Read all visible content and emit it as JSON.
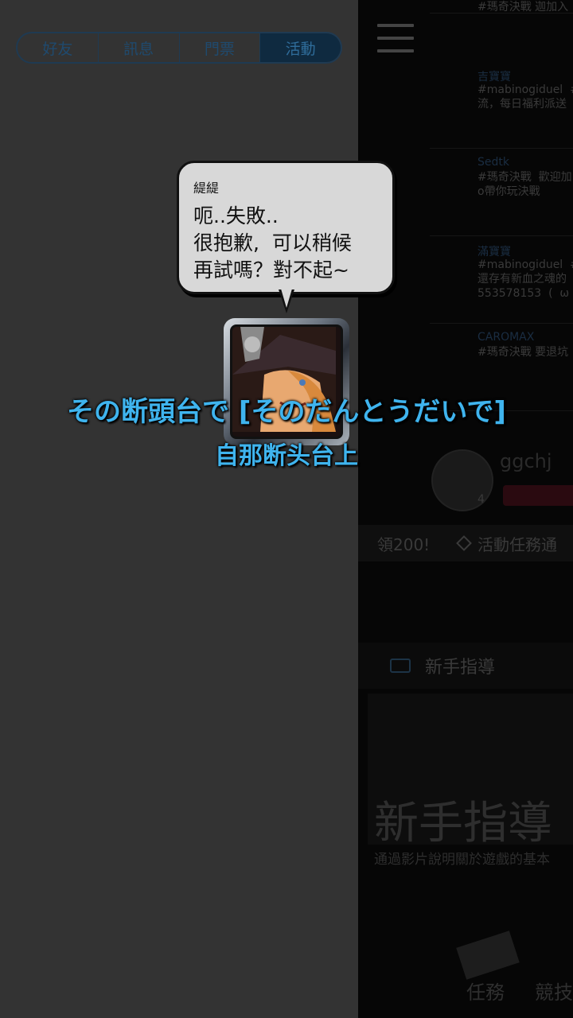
{
  "tabs": [
    {
      "label": "好友",
      "active": false
    },
    {
      "label": "訊息",
      "active": false
    },
    {
      "label": "門票",
      "active": false
    },
    {
      "label": "活動",
      "active": true
    }
  ],
  "feed": [
    {
      "name": "",
      "text": "#瑪奇決戰  迦加入"
    },
    {
      "name": "吉寶寶",
      "text": "#mabinogiduel  #\n流，每日福利派送"
    },
    {
      "name": "Sedtk",
      "text": "#瑪奇決戰  歡迎加\no帶你玩決戰"
    },
    {
      "name": "滿寶寶",
      "text": "#mabinogiduel  #\n還存有新血之魂的\n553578153  (  ω"
    },
    {
      "name": "CAROMAX",
      "text": "#瑪奇決戰  要退坑"
    }
  ],
  "profile": {
    "name": "ggchj",
    "level": "4"
  },
  "activity_bar": {
    "left_text": "領200!",
    "right_text": "活動任務通"
  },
  "guide_row": {
    "label": "新手指導"
  },
  "banner": {
    "title": "新手指導",
    "subtitle": "通過影片說明關於遊戲的基本"
  },
  "nav": {
    "task": "任務",
    "arena": "競技"
  },
  "dialogue": {
    "speaker": "緹緹",
    "message": "呃..失敗..\n很抱歉,  可以稍候\n再試嗎？對不起~"
  },
  "subtitles": {
    "japanese": "その断頭台で [そのだんとうだいで]",
    "chinese": "自那断头台上"
  },
  "colors": {
    "subtitle": "#3fb4ee",
    "drawer_bg": "#333333",
    "tab_active_bg": "#0f2a40",
    "bubble_bg": "#d8d8d8"
  }
}
